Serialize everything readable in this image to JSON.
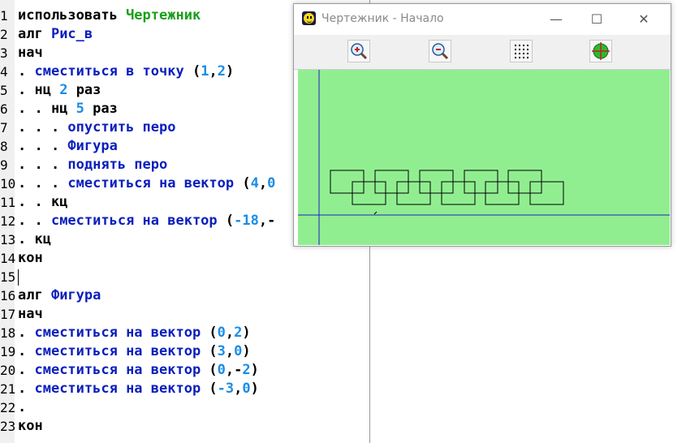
{
  "editor": {
    "lines": [
      {
        "n": "1",
        "segs": [
          {
            "t": "использовать ",
            "c": "kw"
          },
          {
            "t": "Чертежник",
            "c": "mod"
          }
        ]
      },
      {
        "n": "2",
        "segs": [
          {
            "t": "алг ",
            "c": "kw"
          },
          {
            "t": "Рис_в",
            "c": "fn"
          }
        ]
      },
      {
        "n": "3",
        "segs": [
          {
            "t": "нач",
            "c": "kw"
          }
        ]
      },
      {
        "n": "4",
        "segs": [
          {
            "t": ". ",
            "c": "dot"
          },
          {
            "t": "сместиться в точку ",
            "c": "fn"
          },
          {
            "t": "(",
            "c": "kw"
          },
          {
            "t": "1",
            "c": "num"
          },
          {
            "t": ",",
            "c": "kw"
          },
          {
            "t": "2",
            "c": "num"
          },
          {
            "t": ")",
            "c": "kw"
          }
        ]
      },
      {
        "n": "5",
        "segs": [
          {
            "t": ". ",
            "c": "dot"
          },
          {
            "t": "нц ",
            "c": "kw"
          },
          {
            "t": "2",
            "c": "num"
          },
          {
            "t": " раз",
            "c": "kw"
          }
        ]
      },
      {
        "n": "6",
        "segs": [
          {
            "t": ". . ",
            "c": "dot"
          },
          {
            "t": "нц ",
            "c": "kw"
          },
          {
            "t": "5",
            "c": "num"
          },
          {
            "t": " раз",
            "c": "kw"
          }
        ]
      },
      {
        "n": "7",
        "segs": [
          {
            "t": ". . . ",
            "c": "dot"
          },
          {
            "t": "опустить перо",
            "c": "fn"
          }
        ]
      },
      {
        "n": "8",
        "segs": [
          {
            "t": ". . . ",
            "c": "dot"
          },
          {
            "t": "Фигура",
            "c": "fn"
          }
        ]
      },
      {
        "n": "9",
        "segs": [
          {
            "t": ". . . ",
            "c": "dot"
          },
          {
            "t": "поднять перо",
            "c": "fn"
          }
        ]
      },
      {
        "n": "10",
        "segs": [
          {
            "t": ". . . ",
            "c": "dot"
          },
          {
            "t": "сместиться на вектор ",
            "c": "fn"
          },
          {
            "t": "(",
            "c": "kw"
          },
          {
            "t": "4",
            "c": "num"
          },
          {
            "t": ",",
            "c": "kw"
          },
          {
            "t": "0",
            "c": "num"
          }
        ]
      },
      {
        "n": "11",
        "segs": [
          {
            "t": ". . ",
            "c": "dot"
          },
          {
            "t": "кц",
            "c": "kw"
          }
        ]
      },
      {
        "n": "12",
        "segs": [
          {
            "t": ". . ",
            "c": "dot"
          },
          {
            "t": "сместиться на вектор ",
            "c": "fn"
          },
          {
            "t": "(",
            "c": "kw"
          },
          {
            "t": "-18",
            "c": "num"
          },
          {
            "t": ",-",
            "c": "kw"
          }
        ]
      },
      {
        "n": "13",
        "segs": [
          {
            "t": ". ",
            "c": "dot"
          },
          {
            "t": "кц",
            "c": "kw"
          }
        ]
      },
      {
        "n": "14",
        "segs": [
          {
            "t": "кон",
            "c": "kw"
          }
        ]
      },
      {
        "n": "15",
        "segs": []
      },
      {
        "n": "16",
        "segs": [
          {
            "t": "алг ",
            "c": "kw"
          },
          {
            "t": "Фигура",
            "c": "fn"
          }
        ]
      },
      {
        "n": "17",
        "segs": [
          {
            "t": "нач",
            "c": "kw"
          }
        ]
      },
      {
        "n": "18",
        "segs": [
          {
            "t": ". ",
            "c": "dot"
          },
          {
            "t": "сместиться на вектор ",
            "c": "fn"
          },
          {
            "t": "(",
            "c": "kw"
          },
          {
            "t": "0",
            "c": "num"
          },
          {
            "t": ",",
            "c": "kw"
          },
          {
            "t": "2",
            "c": "num"
          },
          {
            "t": ")",
            "c": "kw"
          }
        ]
      },
      {
        "n": "19",
        "segs": [
          {
            "t": ". ",
            "c": "dot"
          },
          {
            "t": "сместиться на вектор ",
            "c": "fn"
          },
          {
            "t": "(",
            "c": "kw"
          },
          {
            "t": "3",
            "c": "num"
          },
          {
            "t": ",",
            "c": "kw"
          },
          {
            "t": "0",
            "c": "num"
          },
          {
            "t": ")",
            "c": "kw"
          }
        ]
      },
      {
        "n": "20",
        "segs": [
          {
            "t": ". ",
            "c": "dot"
          },
          {
            "t": "сместиться на вектор ",
            "c": "fn"
          },
          {
            "t": "(",
            "c": "kw"
          },
          {
            "t": "0",
            "c": "num"
          },
          {
            "t": ",-",
            "c": "kw"
          },
          {
            "t": "2",
            "c": "num"
          },
          {
            "t": ")",
            "c": "kw"
          }
        ]
      },
      {
        "n": "21",
        "segs": [
          {
            "t": ". ",
            "c": "dot"
          },
          {
            "t": "сместиться на вектор ",
            "c": "fn"
          },
          {
            "t": "(",
            "c": "kw"
          },
          {
            "t": "-3",
            "c": "num"
          },
          {
            "t": ",",
            "c": "kw"
          },
          {
            "t": "0",
            "c": "num"
          },
          {
            "t": ")",
            "c": "kw"
          }
        ]
      },
      {
        "n": "22",
        "segs": [
          {
            "t": ".",
            "c": "dot"
          }
        ]
      },
      {
        "n": "23",
        "segs": [
          {
            "t": "кон",
            "c": "kw"
          }
        ]
      }
    ]
  },
  "drawer": {
    "title": "Чертежник - Начало",
    "controls": {
      "minimize": "—",
      "maximize": "☐",
      "close": "✕"
    },
    "toolbar": [
      {
        "name": "zoom-in-button",
        "icon": "zoom-in-icon"
      },
      {
        "name": "zoom-out-button",
        "icon": "zoom-out-icon"
      },
      {
        "name": "grid-button",
        "icon": "grid-icon"
      },
      {
        "name": "center-button",
        "icon": "target-icon"
      }
    ],
    "canvas_color": "#90ee90",
    "axis_color": "#2020c0",
    "shapes_color": "#000000"
  },
  "colors": {
    "keyword": "#000000",
    "function": "#0b1fbd",
    "number": "#1a8ce6",
    "module": "#1a9e1a"
  }
}
